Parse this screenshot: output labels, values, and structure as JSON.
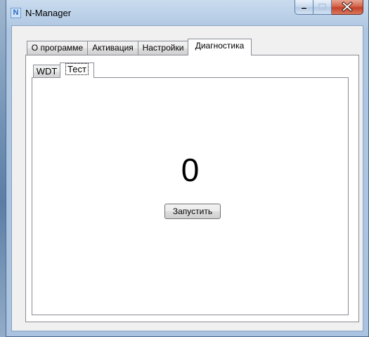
{
  "window": {
    "title": "N-Manager",
    "icon_letter": "N",
    "icon": "app-n-icon"
  },
  "controls": {
    "minimize_icon": "minimize-icon",
    "maximize_icon": "maximize-icon",
    "close_icon": "close-icon"
  },
  "tabs": [
    {
      "label": "О программе"
    },
    {
      "label": "Активация"
    },
    {
      "label": "Настройки"
    },
    {
      "label": "Диагностика"
    }
  ],
  "subtabs": [
    {
      "label": "WDT"
    },
    {
      "label": "Тест"
    }
  ],
  "test": {
    "counter": "0",
    "run_label": "Запустить"
  },
  "colors": {
    "close_button": "#c4412a",
    "title_bar": "#b7cde6",
    "client_bg": "#f0f0f0"
  }
}
